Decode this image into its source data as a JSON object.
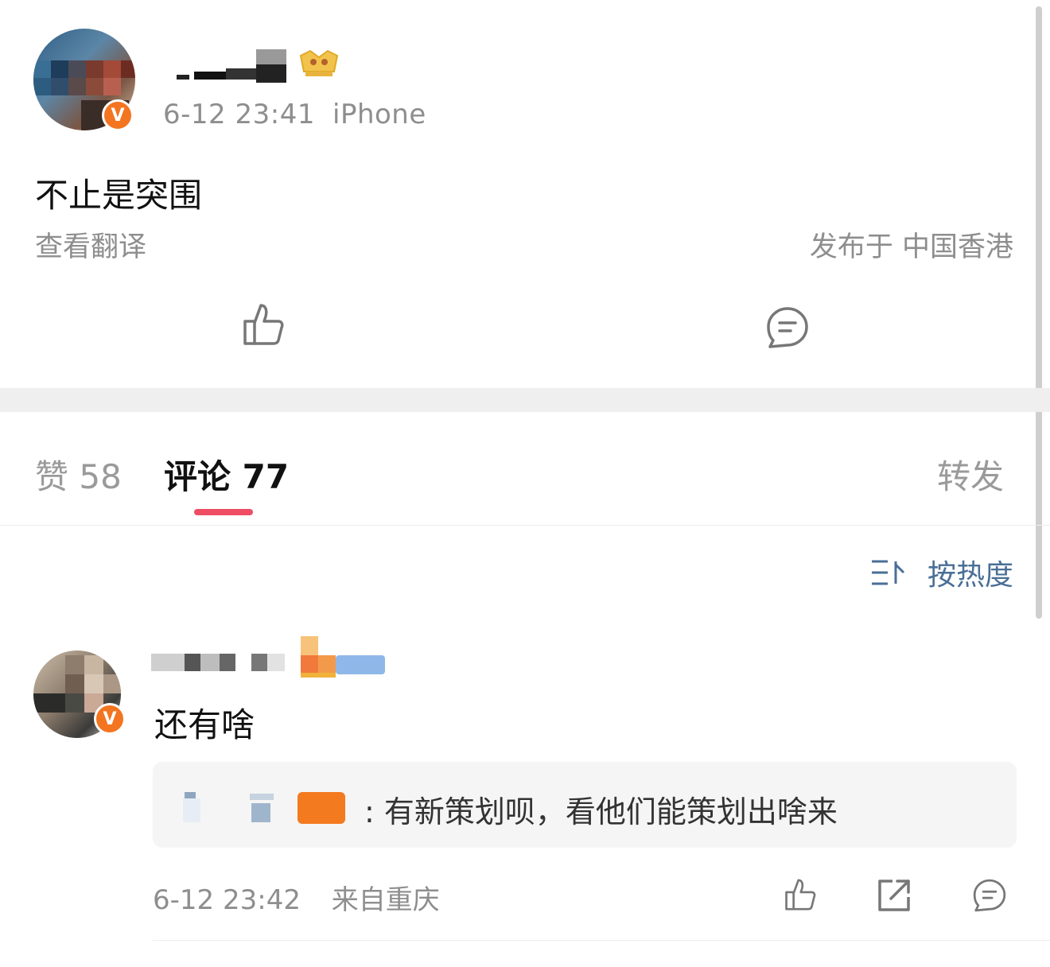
{
  "post": {
    "timestamp": "6-12 23:41",
    "device": "iPhone",
    "text": "不止是突围",
    "translate_label": "查看翻译",
    "location": "发布于 中国香港",
    "verified_badge": "V"
  },
  "tabs": {
    "like_label": "赞 58",
    "comment_label": "评论 77",
    "repost_label": "转发"
  },
  "sort": {
    "label": "按热度",
    "icon": "sort-icon"
  },
  "comment": {
    "text": "还有啥",
    "verified_badge": "V",
    "reply_text": ": 有新策划呗，看他们能策划出啥来",
    "timestamp": "6-12 23:42",
    "source": "来自重庆"
  },
  "colors": {
    "accent_underline": "#ee4d63",
    "verified_orange": "#f37520",
    "sort_blue": "#4a6f96"
  }
}
